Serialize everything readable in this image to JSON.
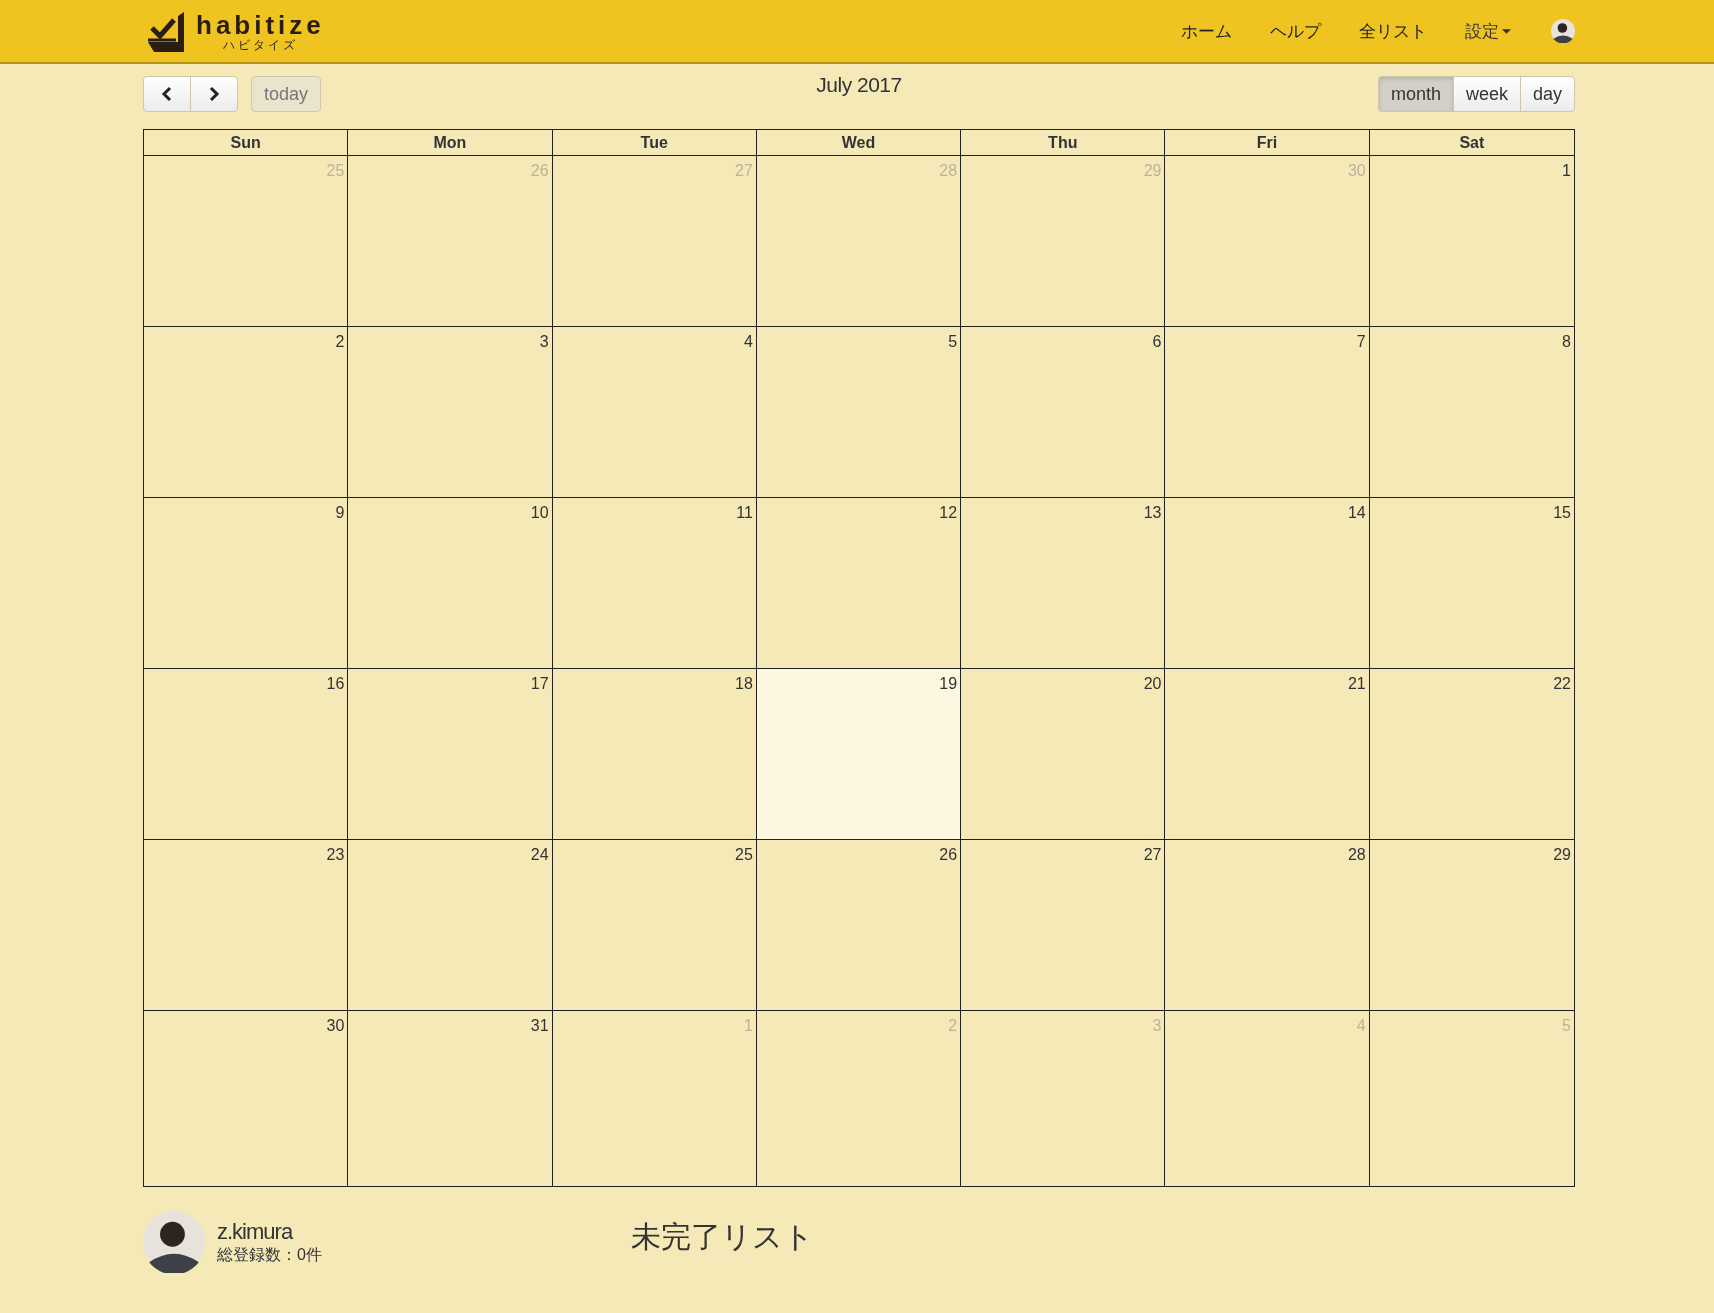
{
  "header": {
    "logo": {
      "name": "habitize",
      "kana": "ハビタイズ"
    },
    "nav": [
      {
        "label": "ホーム"
      },
      {
        "label": "ヘルプ"
      },
      {
        "label": "全リスト"
      }
    ],
    "settings": {
      "label": "設定"
    }
  },
  "toolbar": {
    "today": {
      "label": "today",
      "disabled": true
    },
    "title": "July 2017",
    "views": [
      {
        "label": "month",
        "selected": true
      },
      {
        "label": "week",
        "selected": false
      },
      {
        "label": "day",
        "selected": false
      }
    ]
  },
  "calendar": {
    "weekdays": [
      "Sun",
      "Mon",
      "Tue",
      "Wed",
      "Thu",
      "Fri",
      "Sat"
    ],
    "weeks": [
      [
        {
          "day": "25",
          "other_month": true,
          "today": false
        },
        {
          "day": "26",
          "other_month": true,
          "today": false
        },
        {
          "day": "27",
          "other_month": true,
          "today": false
        },
        {
          "day": "28",
          "other_month": true,
          "today": false
        },
        {
          "day": "29",
          "other_month": true,
          "today": false
        },
        {
          "day": "30",
          "other_month": true,
          "today": false
        },
        {
          "day": "1",
          "other_month": false,
          "today": false
        }
      ],
      [
        {
          "day": "2",
          "other_month": false,
          "today": false
        },
        {
          "day": "3",
          "other_month": false,
          "today": false
        },
        {
          "day": "4",
          "other_month": false,
          "today": false
        },
        {
          "day": "5",
          "other_month": false,
          "today": false
        },
        {
          "day": "6",
          "other_month": false,
          "today": false
        },
        {
          "day": "7",
          "other_month": false,
          "today": false
        },
        {
          "day": "8",
          "other_month": false,
          "today": false
        }
      ],
      [
        {
          "day": "9",
          "other_month": false,
          "today": false
        },
        {
          "day": "10",
          "other_month": false,
          "today": false
        },
        {
          "day": "11",
          "other_month": false,
          "today": false
        },
        {
          "day": "12",
          "other_month": false,
          "today": false
        },
        {
          "day": "13",
          "other_month": false,
          "today": false
        },
        {
          "day": "14",
          "other_month": false,
          "today": false
        },
        {
          "day": "15",
          "other_month": false,
          "today": false
        }
      ],
      [
        {
          "day": "16",
          "other_month": false,
          "today": false
        },
        {
          "day": "17",
          "other_month": false,
          "today": false
        },
        {
          "day": "18",
          "other_month": false,
          "today": false
        },
        {
          "day": "19",
          "other_month": false,
          "today": true
        },
        {
          "day": "20",
          "other_month": false,
          "today": false
        },
        {
          "day": "21",
          "other_month": false,
          "today": false
        },
        {
          "day": "22",
          "other_month": false,
          "today": false
        }
      ],
      [
        {
          "day": "23",
          "other_month": false,
          "today": false
        },
        {
          "day": "24",
          "other_month": false,
          "today": false
        },
        {
          "day": "25",
          "other_month": false,
          "today": false
        },
        {
          "day": "26",
          "other_month": false,
          "today": false
        },
        {
          "day": "27",
          "other_month": false,
          "today": false
        },
        {
          "day": "28",
          "other_month": false,
          "today": false
        },
        {
          "day": "29",
          "other_month": false,
          "today": false
        }
      ],
      [
        {
          "day": "30",
          "other_month": false,
          "today": false
        },
        {
          "day": "31",
          "other_month": false,
          "today": false
        },
        {
          "day": "1",
          "other_month": true,
          "today": false
        },
        {
          "day": "2",
          "other_month": true,
          "today": false
        },
        {
          "day": "3",
          "other_month": true,
          "today": false
        },
        {
          "day": "4",
          "other_month": true,
          "today": false
        },
        {
          "day": "5",
          "other_month": true,
          "today": false
        }
      ]
    ]
  },
  "footer": {
    "user": {
      "name": "z.kimura",
      "count": "総登録数：0件"
    },
    "list_title": "未完了リスト"
  }
}
